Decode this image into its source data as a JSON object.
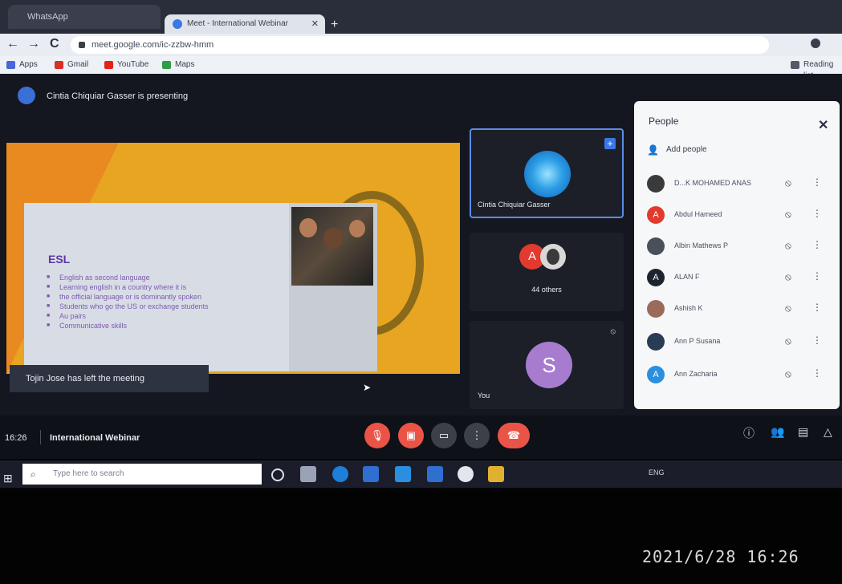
{
  "browser": {
    "tabs": [
      {
        "label": "WhatsApp"
      },
      {
        "label": "Meet - International Webinar",
        "close": "✕"
      }
    ],
    "new_tab": "+",
    "nav": {
      "back": "←",
      "forward": "→",
      "reload": "C"
    },
    "url": "meet.google.com/ic-zzbw-hmm",
    "bookmarks": [
      {
        "label": "Apps",
        "icon_color": "#4a67d6"
      },
      {
        "label": "Gmail",
        "icon_color": "#d93025"
      },
      {
        "label": "YouTube",
        "icon_color": "#e62117"
      },
      {
        "label": "Maps",
        "icon_color": "#2e9c48"
      }
    ],
    "reading_list": "Reading list"
  },
  "meet": {
    "presenting_text": "Cintia Chiquiar Gasser is presenting",
    "slide": {
      "heading": "ESL",
      "bullets": [
        "English as second language",
        "Learning english in a country where it is",
        "the official language or is dominantly spoken",
        "Students who go the US or exchange students",
        "Au pairs",
        "Communicative skills"
      ]
    },
    "toast": "Tojin Jose has left the meeting",
    "tiles": {
      "presenter_name": "Cintia Chiquiar Gasser",
      "pin_icon": "+",
      "others_label": "44 others",
      "others_avatar_letter": "A",
      "self_letter": "S",
      "self_label": "You"
    },
    "people_panel": {
      "title": "People",
      "close": "✕",
      "add_people": "Add people",
      "participants": [
        {
          "name": "D...K MOHAMED ANAS",
          "avatar": "",
          "color": "#3a3a3a"
        },
        {
          "name": "Abdul Hameed",
          "avatar": "A",
          "color": "#e23a2e"
        },
        {
          "name": "Albin Mathews P",
          "avatar": "",
          "color": "#4a4f5b"
        },
        {
          "name": "ALAN F",
          "avatar": "A",
          "color": "#1f2230"
        },
        {
          "name": "Ashish K",
          "avatar": "",
          "color": "#9a6a5a"
        },
        {
          "name": "Ann P Susana",
          "avatar": "",
          "color": "#2a3b55"
        },
        {
          "name": "Ann Zacharia",
          "avatar": "A",
          "color": "#2b8fe0"
        }
      ]
    },
    "bottom": {
      "time": "16:26",
      "meeting_name": "International Webinar",
      "controls": [
        {
          "name": "mic",
          "glyph": "🎙",
          "color": "#ea5446"
        },
        {
          "name": "camera",
          "glyph": "▣",
          "color": "#ea5446"
        },
        {
          "name": "present",
          "glyph": "▭",
          "color": "#3c4049"
        },
        {
          "name": "more",
          "glyph": "⋮",
          "color": "#3c4049"
        },
        {
          "name": "leave",
          "glyph": "☎",
          "color": "#ea5446"
        }
      ]
    }
  },
  "taskbar": {
    "search_placeholder": "Type here to search",
    "tray_text": "ENG"
  },
  "photo_timestamp": "2021/6/28 16:26"
}
